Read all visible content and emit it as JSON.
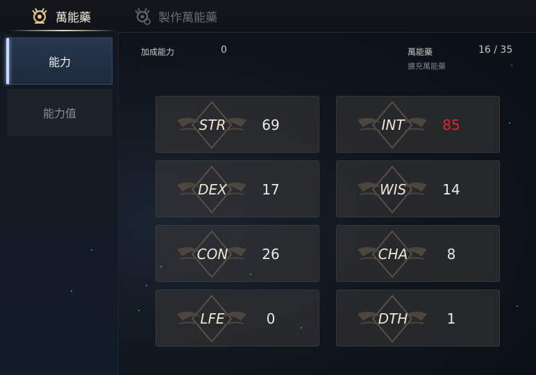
{
  "tabs": [
    {
      "label": "萬能藥",
      "active": true
    },
    {
      "label": "製作萬能藥",
      "active": false
    }
  ],
  "sidebar": {
    "items": [
      {
        "label": "能力",
        "active": true
      },
      {
        "label": "能力值",
        "active": false
      }
    ]
  },
  "info": {
    "bonus_label": "加成能力",
    "bonus_value": "0",
    "elixir_label": "萬能藥",
    "elixir_value": "16 / 35",
    "expand_label": "擴充萬能藥",
    "expand_value": "-"
  },
  "stats": [
    {
      "name": "STR",
      "value": "69",
      "highlight": false
    },
    {
      "name": "INT",
      "value": "85",
      "highlight": true
    },
    {
      "name": "DEX",
      "value": "17",
      "highlight": false
    },
    {
      "name": "WIS",
      "value": "14",
      "highlight": false
    },
    {
      "name": "CON",
      "value": "26",
      "highlight": false
    },
    {
      "name": "CHA",
      "value": "8",
      "highlight": false
    },
    {
      "name": "LFE",
      "value": "0",
      "highlight": false
    },
    {
      "name": "DTH",
      "value": "1",
      "highlight": false
    }
  ],
  "colors": {
    "highlight": "#e0262a",
    "accent": "#e8dcc2"
  }
}
